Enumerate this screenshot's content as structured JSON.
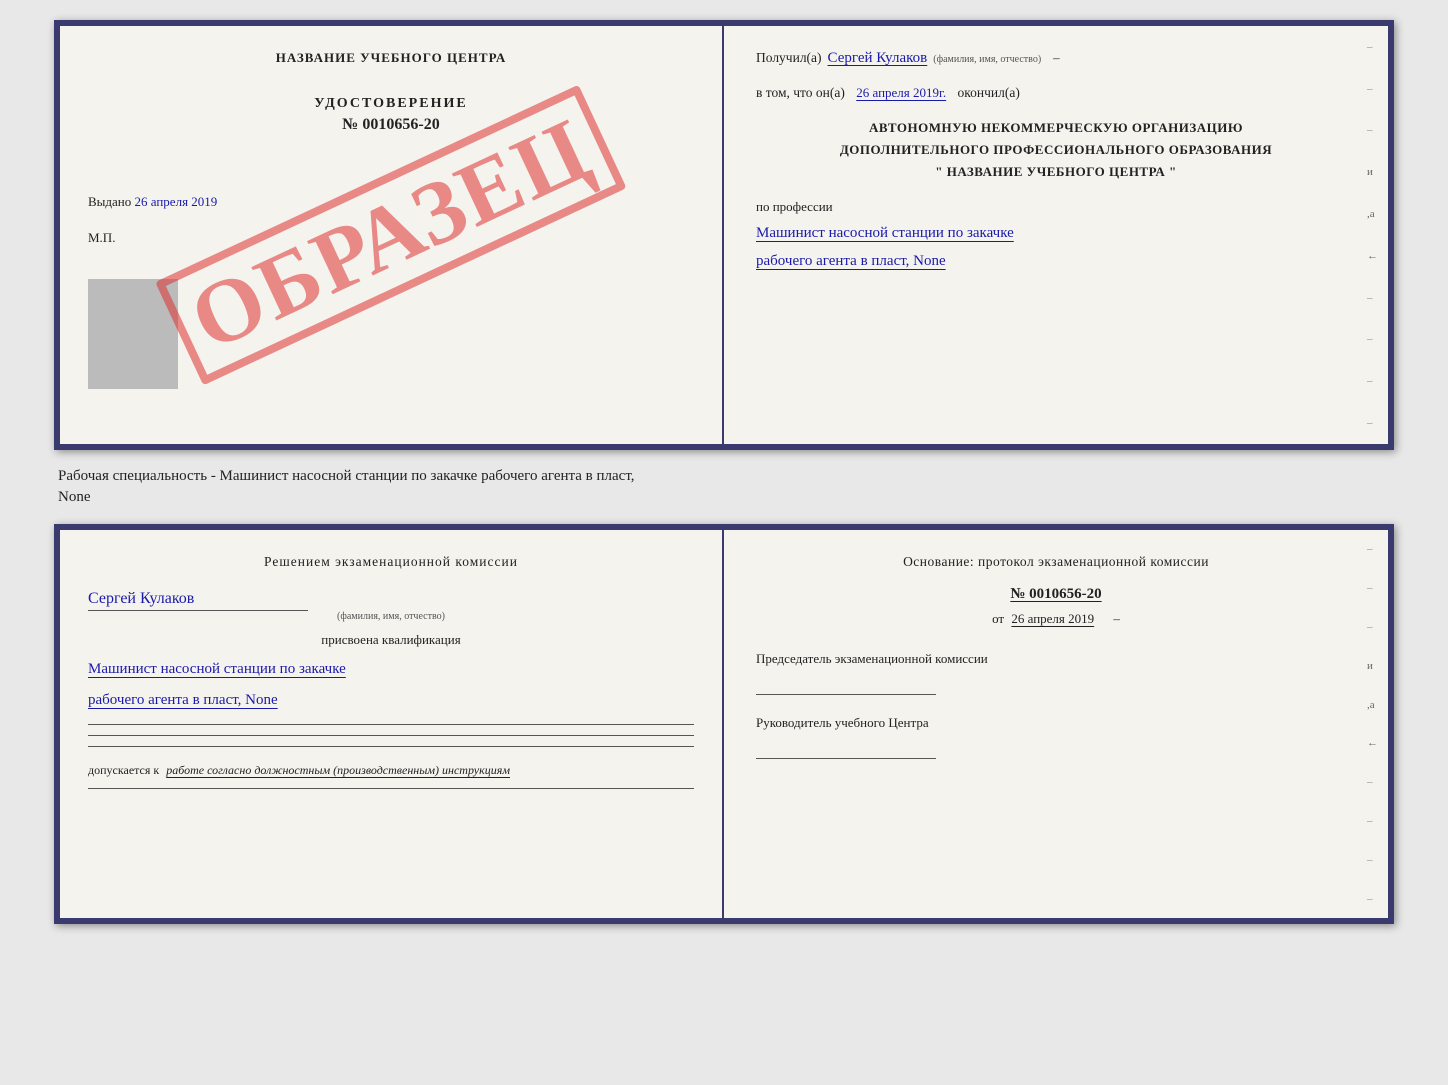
{
  "top_doc": {
    "left": {
      "school_name": "НАЗВАНИЕ УЧЕБНОГО ЦЕНТРА",
      "stamp": "ОБРАЗЕЦ",
      "udostoverenie": "УДОСТОВЕРЕНИЕ",
      "number": "№ 0010656-20",
      "vydano_label": "Выдано",
      "vydano_date": "26 апреля 2019",
      "mp_label": "М.П."
    },
    "right": {
      "received_label": "Получил(а)",
      "received_name": "Сергей Кулаков",
      "received_sub": "(фамилия, имя, отчество)",
      "dash": "–",
      "date_prefix": "в том, что он(а)",
      "date_value": "26 апреля 2019г.",
      "okonchil": "окончил(а)",
      "org_line1": "АВТОНОМНУЮ НЕКОММЕРЧЕСКУЮ ОРГАНИЗАЦИЮ",
      "org_line2": "ДОПОЛНИТЕЛЬНОГО ПРОФЕССИОНАЛЬНОГО ОБРАЗОВАНИЯ",
      "org_line3": "\" НАЗВАНИЕ УЧЕБНОГО ЦЕНТРА \"",
      "profession_label": "по профессии",
      "profession_line1": "Машинист насосной станции по закачке",
      "profession_line2": "рабочего агента в пласт, None"
    }
  },
  "middle_text": {
    "line1": "Рабочая специальность - Машинист насосной станции по закачке рабочего агента в пласт,",
    "line2": "None"
  },
  "bottom_doc": {
    "left": {
      "resolution_text": "Решением экзаменационной комиссии",
      "name": "Сергей Кулаков",
      "name_sub": "(фамилия, имя, отчество)",
      "assigned_text": "присвоена квалификация",
      "qual_line1": "Машинист насосной станции по закачке",
      "qual_line2": "рабочего агента в пласт, None",
      "допускается_label": "допускается к",
      "допускается_value": "работе согласно должностным (производственным) инструкциям"
    },
    "right": {
      "osnov_title": "Основание: протокол экзаменационной комиссии",
      "protocol_number": "№ 0010656-20",
      "date_prefix": "от",
      "date_value": "26 апреля 2019",
      "chairman_label": "Председатель экзаменационной комиссии",
      "director_label": "Руководитель учебного Центра"
    }
  }
}
